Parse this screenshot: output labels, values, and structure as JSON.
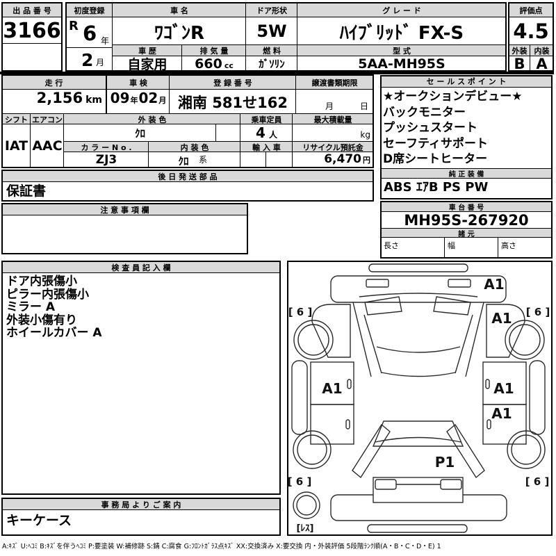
{
  "colors": {
    "header_bg": "#d9d9d9",
    "border": "#000000",
    "paper": "#ffffff"
  },
  "header": {
    "lot": {
      "label": "出 品 番 号",
      "value": "3166"
    },
    "first_reg": {
      "label": "初度登録",
      "era": "R",
      "year": "6",
      "year_unit": "年",
      "month": "2",
      "month_unit": "月"
    },
    "name": {
      "label": "車 名",
      "value": "ﾜｺﾞﾝR"
    },
    "history": {
      "label": "車 歴",
      "value": "自家用"
    },
    "displacement": {
      "label": "排 気 量",
      "value": "660",
      "unit": "cc"
    },
    "doors": {
      "label": "ドア形状",
      "value": "5W"
    },
    "fuel": {
      "label": "燃 料",
      "value": "ｶﾞｿﾘﾝ"
    },
    "grade": {
      "label": "グ レ ー ド",
      "value": "ﾊｲﾌﾞﾘｯﾄﾞ FX-S"
    },
    "model": {
      "label": "型 式",
      "value": "5AA-MH95S"
    },
    "score": {
      "label": "評価点",
      "value": "4.5"
    },
    "exterior": {
      "label": "外装",
      "grade": "B"
    },
    "interior": {
      "label": "内装",
      "grade": "A"
    }
  },
  "details": {
    "mileage": {
      "label": "走 行",
      "value": "2,156",
      "unit": "km"
    },
    "inspection": {
      "label": "車 検",
      "year": "09",
      "year_unit": "年",
      "month": "02",
      "month_unit": "月"
    },
    "registration": {
      "label": "登 録 番 号",
      "value": "湘南 581せ162"
    },
    "transfer": {
      "label": "譲渡書類期限",
      "month_unit": "月",
      "day_unit": "日"
    },
    "shift": {
      "label": "シフト",
      "value": "IAT"
    },
    "aircon": {
      "label": "エアコン",
      "value": "AAC"
    },
    "ext_color": {
      "label": "外 装 色",
      "value": "ｸﾛ"
    },
    "capacity": {
      "label": "乗車定員",
      "value": "4",
      "unit": "人"
    },
    "payload": {
      "label": "最大積載量",
      "unit": "kg"
    },
    "color_no": {
      "label": "カ ラ ー N o .",
      "value": "ZJ3"
    },
    "int_color": {
      "label": "内 装 色",
      "value": "ｸﾛ",
      "suffix": "系"
    },
    "import_car": {
      "label": "輸 入 車"
    },
    "recycle": {
      "label": "リサイクル預託金",
      "value": "6,470",
      "unit": "円"
    }
  },
  "later_parts": {
    "label": "後 日 発 送 部 品",
    "value": "保証書"
  },
  "notes": {
    "label": "注 意 事 項 欄"
  },
  "sales_points": {
    "label": "セ ー ル ス ポ イ ン ト",
    "items": [
      "★オークションデビュー★",
      "バックモニター",
      "プッシュスタート",
      "セーフティサポート",
      "D席シートヒーター"
    ]
  },
  "equipment": {
    "label": "純 正 装 備",
    "value": "ABS ｴｱB PS PW"
  },
  "chassis": {
    "label": "車 台 番 号",
    "value": "MH95S-267920"
  },
  "specs": {
    "label": "諸 元",
    "length_label": "長さ",
    "width_label": "幅",
    "height_label": "高さ"
  },
  "inspector": {
    "label": "検 査 員 記 入 欄",
    "items": [
      "ドア内張傷小",
      "ピラー内張傷小",
      "ミラー A",
      "外装小傷有り",
      "ホイールカバー A"
    ]
  },
  "office": {
    "label": "事 務 局 よ り ご 案 内",
    "value": "キーケース"
  },
  "diagram": {
    "marks": {
      "front_bumper_right": "A1",
      "front_fender_right": "A1",
      "door_left": "A1",
      "door_right": "A1",
      "rear_quarter_right": "A1",
      "rear_gate": "P1",
      "tire_front_left": "[ 6 ]",
      "tire_front_right": "[ 6 ]",
      "tire_rear_left": "[ 6 ]",
      "tire_rear_right": "[ 6 ]",
      "spare_tire": "[ﾚｽ]"
    }
  },
  "legend": "A:ｷｽﾞ U:ﾍｺﾐ B:ｷｽﾞを伴うﾍｺﾐ P:要塗装 W:補修跡 S:錆 C:腐食 G:ﾌﾛﾝﾄｶﾞﾗｽ点ｷｽﾞ XX:交換済み X:要交換  内・外装評価 5段階ﾗﾝｸ順(A・B・C・D・E) 1"
}
